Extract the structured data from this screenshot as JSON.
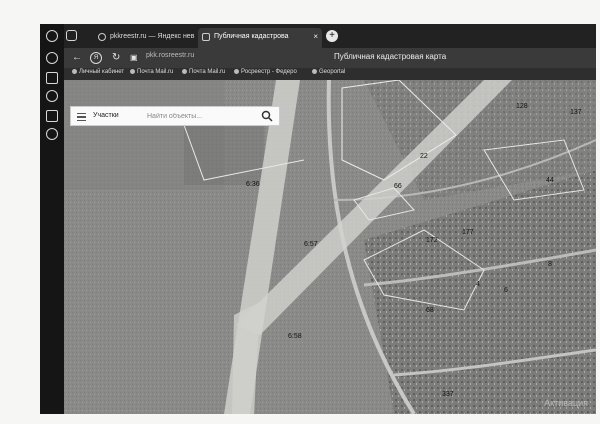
{
  "browser": {
    "tabs": [
      {
        "label": "pkkreestr.ru — Яндекс нев",
        "active": false
      },
      {
        "label": "Публичная кадастрова",
        "active": true
      }
    ],
    "close_glyph": "×",
    "new_tab_glyph": "+",
    "url": "pkk.rosreestr.ru",
    "page_title": "Публичная кадастровая карта",
    "bookmarks": [
      "Личный кабинет",
      "Почта Mail.ru",
      "Почта Mail.ru",
      "Росреестр - Федеро",
      "Geoportal"
    ],
    "rail_icons": [
      "profile-icon",
      "history-icon",
      "bookmarks-icon",
      "downloads-icon",
      "panel-icon",
      "settings-icon"
    ]
  },
  "search": {
    "mode": "Участки",
    "placeholder": "Найти объекты..."
  },
  "map": {
    "parcel_labels": [
      "6:36",
      "6:57",
      "6:58",
      "172",
      "177",
      "68",
      "66",
      "22",
      "44",
      "8",
      "6",
      "4",
      "337",
      "128",
      "137"
    ]
  },
  "watermark": "Активация"
}
